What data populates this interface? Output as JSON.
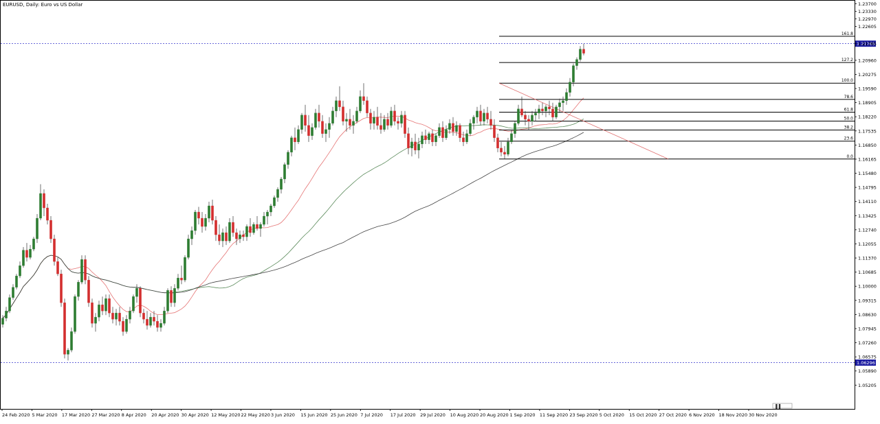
{
  "chart_data": {
    "type": "candlestick",
    "title": "EURUSD, Daily:  Euro vs US Dollar",
    "colors": {
      "bull": "#2e7d32",
      "bear": "#d32f2f",
      "ma_fast": "#e57373",
      "ma_mid": "#5a8a5a",
      "ma_slow": "#444444",
      "fib_line": "#000000",
      "fib_diag": "#e07070",
      "h_dotted": "#3333cc",
      "price_label_bg": "#1a1aa0",
      "price_label_fg": "#ffffff"
    },
    "y_axis": {
      "min": 1.0465,
      "max": 1.2375,
      "ticks": [
        "1.23700",
        "1.23330",
        "1.22970",
        "1.22605",
        "1.21765",
        "1.20960",
        "1.20275",
        "1.19590",
        "1.18905",
        "1.18220",
        "1.17535",
        "1.16850",
        "1.16165",
        "1.15480",
        "1.14795",
        "1.14110",
        "1.13425",
        "1.12740",
        "1.12055",
        "1.11370",
        "1.10685",
        "1.10000",
        "1.09315",
        "1.08630",
        "1.07945",
        "1.07260",
        "1.06575",
        "1.05890",
        "1.05205"
      ]
    },
    "x_axis_labels": [
      "24 Feb 2020",
      "5 Mar 2020",
      "17 Mar 2020",
      "27 Mar 2020",
      "8 Apr 2020",
      "20 Apr 2020",
      "30 Apr 2020",
      "12 May 2020",
      "22 May 2020",
      "3 Jun 2020",
      "15 Jun 2020",
      "25 Jun 2020",
      "7 Jul 2020",
      "17 Jul 2020",
      "29 Jul 2020",
      "10 Aug 2020",
      "20 Aug 2020",
      "1 Sep 2020",
      "11 Sep 2020",
      "23 Sep 2020",
      "5 Oct 2020",
      "15 Oct 2020",
      "27 Oct 2020",
      "6 Nov 2020",
      "18 Nov 2020",
      "30 Nov 2020"
    ],
    "horizontal_price_labels": [
      {
        "price": 1.21765,
        "label": "1.21765"
      },
      {
        "price": 1.06296,
        "label": "1.06296"
      }
    ],
    "fibonacci": {
      "low": 1.1617,
      "high": 1.1985,
      "levels": [
        {
          "ratio": 0.0,
          "label": "0.0"
        },
        {
          "ratio": 0.236,
          "label": "23.6"
        },
        {
          "ratio": 0.382,
          "label": "38.2"
        },
        {
          "ratio": 0.5,
          "label": "50.0"
        },
        {
          "ratio": 0.618,
          "label": "61.8"
        },
        {
          "ratio": 0.786,
          "label": "78.6"
        },
        {
          "ratio": 1.0,
          "label": "100.0"
        },
        {
          "ratio": 1.272,
          "label": "127.2"
        },
        {
          "ratio": 1.618,
          "label": "161.8"
        }
      ]
    },
    "bars": [
      {
        "o": 1.0815,
        "h": 1.086,
        "l": 1.08,
        "c": 1.0845
      },
      {
        "o": 1.0845,
        "h": 1.09,
        "l": 1.083,
        "c": 1.088
      },
      {
        "o": 1.088,
        "h": 1.096,
        "l": 1.087,
        "c": 1.0945
      },
      {
        "o": 1.0945,
        "h": 1.101,
        "l": 1.0935,
        "c": 1.0995
      },
      {
        "o": 1.0995,
        "h": 1.106,
        "l": 1.0985,
        "c": 1.105
      },
      {
        "o": 1.105,
        "h": 1.112,
        "l": 1.104,
        "c": 1.11
      },
      {
        "o": 1.11,
        "h": 1.119,
        "l": 1.109,
        "c": 1.1175
      },
      {
        "o": 1.1175,
        "h": 1.121,
        "l": 1.112,
        "c": 1.114
      },
      {
        "o": 1.114,
        "h": 1.12,
        "l": 1.113,
        "c": 1.118
      },
      {
        "o": 1.118,
        "h": 1.124,
        "l": 1.117,
        "c": 1.123
      },
      {
        "o": 1.123,
        "h": 1.135,
        "l": 1.121,
        "c": 1.133
      },
      {
        "o": 1.133,
        "h": 1.1495,
        "l": 1.132,
        "c": 1.145
      },
      {
        "o": 1.145,
        "h": 1.147,
        "l": 1.134,
        "c": 1.138
      },
      {
        "o": 1.138,
        "h": 1.14,
        "l": 1.13,
        "c": 1.132
      },
      {
        "o": 1.132,
        "h": 1.134,
        "l": 1.121,
        "c": 1.123
      },
      {
        "o": 1.123,
        "h": 1.125,
        "l": 1.11,
        "c": 1.112
      },
      {
        "o": 1.112,
        "h": 1.114,
        "l": 1.105,
        "c": 1.106
      },
      {
        "o": 1.106,
        "h": 1.108,
        "l": 1.09,
        "c": 1.092
      },
      {
        "o": 1.092,
        "h": 1.094,
        "l": 1.065,
        "c": 1.067
      },
      {
        "o": 1.067,
        "h": 1.07,
        "l": 1.064,
        "c": 1.069
      },
      {
        "o": 1.069,
        "h": 1.08,
        "l": 1.068,
        "c": 1.078
      },
      {
        "o": 1.078,
        "h": 1.096,
        "l": 1.077,
        "c": 1.095
      },
      {
        "o": 1.095,
        "h": 1.103,
        "l": 1.093,
        "c": 1.102
      },
      {
        "o": 1.102,
        "h": 1.115,
        "l": 1.101,
        "c": 1.113
      },
      {
        "o": 1.113,
        "h": 1.115,
        "l": 1.101,
        "c": 1.103
      },
      {
        "o": 1.103,
        "h": 1.105,
        "l": 1.09,
        "c": 1.092
      },
      {
        "o": 1.092,
        "h": 1.094,
        "l": 1.08,
        "c": 1.082
      },
      {
        "o": 1.082,
        "h": 1.087,
        "l": 1.078,
        "c": 1.085
      },
      {
        "o": 1.085,
        "h": 1.093,
        "l": 1.083,
        "c": 1.091
      },
      {
        "o": 1.091,
        "h": 1.095,
        "l": 1.086,
        "c": 1.088
      },
      {
        "o": 1.088,
        "h": 1.096,
        "l": 1.086,
        "c": 1.094
      },
      {
        "o": 1.094,
        "h": 1.096,
        "l": 1.085,
        "c": 1.087
      },
      {
        "o": 1.087,
        "h": 1.09,
        "l": 1.082,
        "c": 1.084
      },
      {
        "o": 1.084,
        "h": 1.089,
        "l": 1.081,
        "c": 1.087
      },
      {
        "o": 1.087,
        "h": 1.09,
        "l": 1.081,
        "c": 1.083
      },
      {
        "o": 1.083,
        "h": 1.085,
        "l": 1.076,
        "c": 1.078
      },
      {
        "o": 1.078,
        "h": 1.086,
        "l": 1.077,
        "c": 1.084
      },
      {
        "o": 1.084,
        "h": 1.09,
        "l": 1.082,
        "c": 1.088
      },
      {
        "o": 1.088,
        "h": 1.096,
        "l": 1.087,
        "c": 1.095
      },
      {
        "o": 1.095,
        "h": 1.101,
        "l": 1.092,
        "c": 1.099
      },
      {
        "o": 1.099,
        "h": 1.1,
        "l": 1.085,
        "c": 1.087
      },
      {
        "o": 1.087,
        "h": 1.089,
        "l": 1.082,
        "c": 1.084
      },
      {
        "o": 1.084,
        "h": 1.088,
        "l": 1.079,
        "c": 1.081
      },
      {
        "o": 1.081,
        "h": 1.087,
        "l": 1.08,
        "c": 1.085
      },
      {
        "o": 1.085,
        "h": 1.088,
        "l": 1.081,
        "c": 1.083
      },
      {
        "o": 1.083,
        "h": 1.086,
        "l": 1.078,
        "c": 1.08
      },
      {
        "o": 1.08,
        "h": 1.084,
        "l": 1.078,
        "c": 1.082
      },
      {
        "o": 1.082,
        "h": 1.09,
        "l": 1.081,
        "c": 1.088
      },
      {
        "o": 1.088,
        "h": 1.099,
        "l": 1.087,
        "c": 1.098
      },
      {
        "o": 1.098,
        "h": 1.1,
        "l": 1.09,
        "c": 1.092
      },
      {
        "o": 1.092,
        "h": 1.101,
        "l": 1.09,
        "c": 1.099
      },
      {
        "o": 1.099,
        "h": 1.106,
        "l": 1.098,
        "c": 1.104
      },
      {
        "o": 1.104,
        "h": 1.11,
        "l": 1.101,
        "c": 1.103
      },
      {
        "o": 1.103,
        "h": 1.115,
        "l": 1.102,
        "c": 1.114
      },
      {
        "o": 1.114,
        "h": 1.125,
        "l": 1.113,
        "c": 1.123
      },
      {
        "o": 1.123,
        "h": 1.129,
        "l": 1.12,
        "c": 1.127
      },
      {
        "o": 1.127,
        "h": 1.137,
        "l": 1.125,
        "c": 1.136
      },
      {
        "o": 1.136,
        "h": 1.1385,
        "l": 1.13,
        "c": 1.133
      },
      {
        "o": 1.133,
        "h": 1.136,
        "l": 1.126,
        "c": 1.129
      },
      {
        "o": 1.129,
        "h": 1.135,
        "l": 1.127,
        "c": 1.133
      },
      {
        "o": 1.133,
        "h": 1.141,
        "l": 1.131,
        "c": 1.139
      },
      {
        "o": 1.139,
        "h": 1.142,
        "l": 1.13,
        "c": 1.132
      },
      {
        "o": 1.132,
        "h": 1.134,
        "l": 1.122,
        "c": 1.125
      },
      {
        "o": 1.125,
        "h": 1.13,
        "l": 1.12,
        "c": 1.122
      },
      {
        "o": 1.122,
        "h": 1.128,
        "l": 1.119,
        "c": 1.126
      },
      {
        "o": 1.126,
        "h": 1.129,
        "l": 1.12,
        "c": 1.122
      },
      {
        "o": 1.122,
        "h": 1.133,
        "l": 1.121,
        "c": 1.131
      },
      {
        "o": 1.131,
        "h": 1.134,
        "l": 1.124,
        "c": 1.126
      },
      {
        "o": 1.126,
        "h": 1.128,
        "l": 1.12,
        "c": 1.123
      },
      {
        "o": 1.123,
        "h": 1.127,
        "l": 1.121,
        "c": 1.125
      },
      {
        "o": 1.125,
        "h": 1.127,
        "l": 1.122,
        "c": 1.124
      },
      {
        "o": 1.124,
        "h": 1.13,
        "l": 1.122,
        "c": 1.129
      },
      {
        "o": 1.129,
        "h": 1.133,
        "l": 1.124,
        "c": 1.126
      },
      {
        "o": 1.126,
        "h": 1.131,
        "l": 1.125,
        "c": 1.13
      },
      {
        "o": 1.13,
        "h": 1.134,
        "l": 1.127,
        "c": 1.128
      },
      {
        "o": 1.128,
        "h": 1.131,
        "l": 1.124,
        "c": 1.13
      },
      {
        "o": 1.13,
        "h": 1.136,
        "l": 1.129,
        "c": 1.134
      },
      {
        "o": 1.134,
        "h": 1.137,
        "l": 1.13,
        "c": 1.136
      },
      {
        "o": 1.136,
        "h": 1.14,
        "l": 1.134,
        "c": 1.139
      },
      {
        "o": 1.139,
        "h": 1.144,
        "l": 1.138,
        "c": 1.143
      },
      {
        "o": 1.143,
        "h": 1.148,
        "l": 1.141,
        "c": 1.147
      },
      {
        "o": 1.147,
        "h": 1.153,
        "l": 1.145,
        "c": 1.152
      },
      {
        "o": 1.152,
        "h": 1.16,
        "l": 1.15,
        "c": 1.159
      },
      {
        "o": 1.159,
        "h": 1.166,
        "l": 1.157,
        "c": 1.165
      },
      {
        "o": 1.165,
        "h": 1.173,
        "l": 1.163,
        "c": 1.172
      },
      {
        "o": 1.172,
        "h": 1.177,
        "l": 1.166,
        "c": 1.17
      },
      {
        "o": 1.17,
        "h": 1.178,
        "l": 1.169,
        "c": 1.176
      },
      {
        "o": 1.176,
        "h": 1.184,
        "l": 1.174,
        "c": 1.183
      },
      {
        "o": 1.183,
        "h": 1.188,
        "l": 1.175,
        "c": 1.178
      },
      {
        "o": 1.178,
        "h": 1.183,
        "l": 1.17,
        "c": 1.173
      },
      {
        "o": 1.173,
        "h": 1.179,
        "l": 1.171,
        "c": 1.177
      },
      {
        "o": 1.177,
        "h": 1.186,
        "l": 1.176,
        "c": 1.184
      },
      {
        "o": 1.184,
        "h": 1.188,
        "l": 1.177,
        "c": 1.18
      },
      {
        "o": 1.18,
        "h": 1.183,
        "l": 1.172,
        "c": 1.174
      },
      {
        "o": 1.174,
        "h": 1.179,
        "l": 1.17,
        "c": 1.176
      },
      {
        "o": 1.176,
        "h": 1.182,
        "l": 1.172,
        "c": 1.179
      },
      {
        "o": 1.179,
        "h": 1.187,
        "l": 1.178,
        "c": 1.185
      },
      {
        "o": 1.185,
        "h": 1.192,
        "l": 1.182,
        "c": 1.19
      },
      {
        "o": 1.19,
        "h": 1.197,
        "l": 1.185,
        "c": 1.187
      },
      {
        "o": 1.187,
        "h": 1.19,
        "l": 1.178,
        "c": 1.18
      },
      {
        "o": 1.18,
        "h": 1.184,
        "l": 1.175,
        "c": 1.181
      },
      {
        "o": 1.181,
        "h": 1.186,
        "l": 1.176,
        "c": 1.178
      },
      {
        "o": 1.178,
        "h": 1.183,
        "l": 1.174,
        "c": 1.18
      },
      {
        "o": 1.18,
        "h": 1.187,
        "l": 1.179,
        "c": 1.185
      },
      {
        "o": 1.185,
        "h": 1.195,
        "l": 1.184,
        "c": 1.192
      },
      {
        "o": 1.192,
        "h": 1.1985,
        "l": 1.188,
        "c": 1.19
      },
      {
        "o": 1.19,
        "h": 1.192,
        "l": 1.182,
        "c": 1.184
      },
      {
        "o": 1.184,
        "h": 1.186,
        "l": 1.176,
        "c": 1.179
      },
      {
        "o": 1.179,
        "h": 1.185,
        "l": 1.176,
        "c": 1.182
      },
      {
        "o": 1.182,
        "h": 1.187,
        "l": 1.176,
        "c": 1.178
      },
      {
        "o": 1.178,
        "h": 1.184,
        "l": 1.174,
        "c": 1.176
      },
      {
        "o": 1.176,
        "h": 1.183,
        "l": 1.175,
        "c": 1.181
      },
      {
        "o": 1.181,
        "h": 1.184,
        "l": 1.176,
        "c": 1.178
      },
      {
        "o": 1.178,
        "h": 1.187,
        "l": 1.177,
        "c": 1.185
      },
      {
        "o": 1.185,
        "h": 1.188,
        "l": 1.178,
        "c": 1.18
      },
      {
        "o": 1.18,
        "h": 1.182,
        "l": 1.176,
        "c": 1.179
      },
      {
        "o": 1.179,
        "h": 1.185,
        "l": 1.177,
        "c": 1.183
      },
      {
        "o": 1.183,
        "h": 1.185,
        "l": 1.172,
        "c": 1.174
      },
      {
        "o": 1.174,
        "h": 1.177,
        "l": 1.164,
        "c": 1.167
      },
      {
        "o": 1.167,
        "h": 1.172,
        "l": 1.163,
        "c": 1.17
      },
      {
        "o": 1.17,
        "h": 1.174,
        "l": 1.164,
        "c": 1.166
      },
      {
        "o": 1.166,
        "h": 1.172,
        "l": 1.162,
        "c": 1.169
      },
      {
        "o": 1.169,
        "h": 1.175,
        "l": 1.167,
        "c": 1.173
      },
      {
        "o": 1.173,
        "h": 1.176,
        "l": 1.169,
        "c": 1.171
      },
      {
        "o": 1.171,
        "h": 1.175,
        "l": 1.169,
        "c": 1.174
      },
      {
        "o": 1.174,
        "h": 1.176,
        "l": 1.168,
        "c": 1.17
      },
      {
        "o": 1.17,
        "h": 1.174,
        "l": 1.168,
        "c": 1.173
      },
      {
        "o": 1.173,
        "h": 1.179,
        "l": 1.172,
        "c": 1.177
      },
      {
        "o": 1.177,
        "h": 1.18,
        "l": 1.17,
        "c": 1.172
      },
      {
        "o": 1.172,
        "h": 1.178,
        "l": 1.171,
        "c": 1.176
      },
      {
        "o": 1.176,
        "h": 1.181,
        "l": 1.174,
        "c": 1.179
      },
      {
        "o": 1.179,
        "h": 1.182,
        "l": 1.173,
        "c": 1.175
      },
      {
        "o": 1.175,
        "h": 1.18,
        "l": 1.173,
        "c": 1.178
      },
      {
        "o": 1.178,
        "h": 1.179,
        "l": 1.17,
        "c": 1.172
      },
      {
        "o": 1.172,
        "h": 1.175,
        "l": 1.168,
        "c": 1.17
      },
      {
        "o": 1.17,
        "h": 1.176,
        "l": 1.169,
        "c": 1.174
      },
      {
        "o": 1.174,
        "h": 1.181,
        "l": 1.173,
        "c": 1.179
      },
      {
        "o": 1.179,
        "h": 1.183,
        "l": 1.176,
        "c": 1.182
      },
      {
        "o": 1.182,
        "h": 1.187,
        "l": 1.179,
        "c": 1.185
      },
      {
        "o": 1.185,
        "h": 1.188,
        "l": 1.178,
        "c": 1.18
      },
      {
        "o": 1.18,
        "h": 1.186,
        "l": 1.178,
        "c": 1.184
      },
      {
        "o": 1.184,
        "h": 1.187,
        "l": 1.179,
        "c": 1.181
      },
      {
        "o": 1.181,
        "h": 1.185,
        "l": 1.176,
        "c": 1.178
      },
      {
        "o": 1.178,
        "h": 1.181,
        "l": 1.17,
        "c": 1.172
      },
      {
        "o": 1.172,
        "h": 1.174,
        "l": 1.165,
        "c": 1.167
      },
      {
        "o": 1.167,
        "h": 1.17,
        "l": 1.163,
        "c": 1.165
      },
      {
        "o": 1.165,
        "h": 1.168,
        "l": 1.1617,
        "c": 1.164
      },
      {
        "o": 1.164,
        "h": 1.172,
        "l": 1.163,
        "c": 1.17
      },
      {
        "o": 1.17,
        "h": 1.176,
        "l": 1.169,
        "c": 1.174
      },
      {
        "o": 1.174,
        "h": 1.18,
        "l": 1.172,
        "c": 1.179
      },
      {
        "o": 1.179,
        "h": 1.188,
        "l": 1.178,
        "c": 1.186
      },
      {
        "o": 1.186,
        "h": 1.192,
        "l": 1.182,
        "c": 1.183
      },
      {
        "o": 1.183,
        "h": 1.185,
        "l": 1.178,
        "c": 1.181
      },
      {
        "o": 1.181,
        "h": 1.183,
        "l": 1.176,
        "c": 1.18
      },
      {
        "o": 1.18,
        "h": 1.185,
        "l": 1.178,
        "c": 1.183
      },
      {
        "o": 1.183,
        "h": 1.186,
        "l": 1.18,
        "c": 1.184
      },
      {
        "o": 1.184,
        "h": 1.188,
        "l": 1.181,
        "c": 1.186
      },
      {
        "o": 1.186,
        "h": 1.189,
        "l": 1.183,
        "c": 1.185
      },
      {
        "o": 1.185,
        "h": 1.188,
        "l": 1.182,
        "c": 1.187
      },
      {
        "o": 1.187,
        "h": 1.19,
        "l": 1.183,
        "c": 1.186
      },
      {
        "o": 1.186,
        "h": 1.189,
        "l": 1.18,
        "c": 1.182
      },
      {
        "o": 1.182,
        "h": 1.188,
        "l": 1.181,
        "c": 1.187
      },
      {
        "o": 1.187,
        "h": 1.191,
        "l": 1.184,
        "c": 1.189
      },
      {
        "o": 1.189,
        "h": 1.192,
        "l": 1.185,
        "c": 1.19
      },
      {
        "o": 1.19,
        "h": 1.196,
        "l": 1.188,
        "c": 1.194
      },
      {
        "o": 1.194,
        "h": 1.201,
        "l": 1.192,
        "c": 1.199
      },
      {
        "o": 1.199,
        "h": 1.208,
        "l": 1.197,
        "c": 1.207
      },
      {
        "o": 1.207,
        "h": 1.211,
        "l": 1.205,
        "c": 1.21
      },
      {
        "o": 1.21,
        "h": 1.2165,
        "l": 1.209,
        "c": 1.215
      },
      {
        "o": 1.215,
        "h": 1.2176,
        "l": 1.212,
        "c": 1.213
      }
    ]
  },
  "toolbar": {
    "zoom_icon_label": "▐▐"
  }
}
